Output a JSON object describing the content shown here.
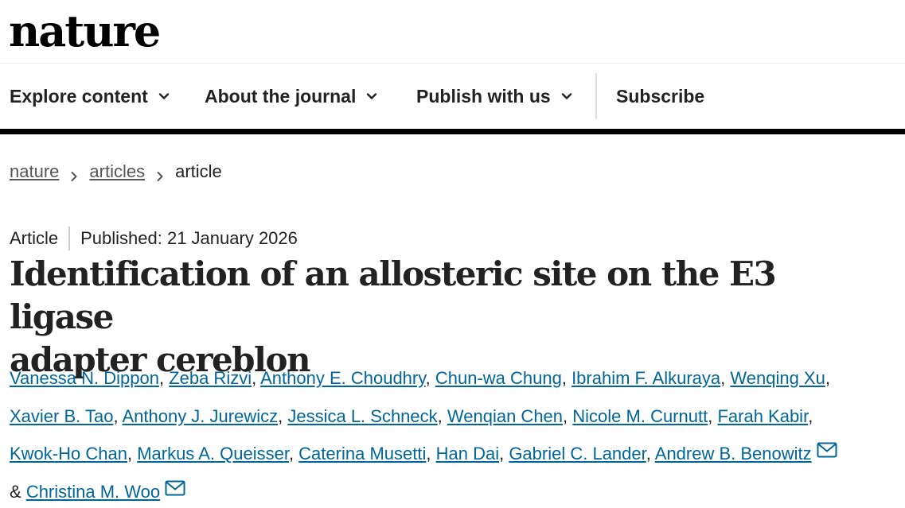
{
  "header": {
    "logo": "nature"
  },
  "nav": {
    "items": [
      {
        "label": "Explore content",
        "has_dropdown": true
      },
      {
        "label": "About the journal",
        "has_dropdown": true
      },
      {
        "label": "Publish with us",
        "has_dropdown": true
      },
      {
        "label": "Subscribe",
        "has_dropdown": false
      }
    ],
    "chevron_icon": "chevron-down-icon"
  },
  "breadcrumb": {
    "items": [
      "nature",
      "articles"
    ],
    "current": "article",
    "separator_icon": "chevron-right-icon"
  },
  "meta": {
    "type": "Article",
    "published": "Published: 21 January 2026"
  },
  "article": {
    "title_line1": "Identification of an allosteric site on the E3 ligase",
    "title_line2": "adapter cereblon"
  },
  "authors": {
    "names": [
      "Vanessa N. Dippon",
      "Zeba Rizvi",
      "Anthony E. Choudhry",
      "Chun-wa Chung",
      "Ibrahim F. Alkuraya",
      "Wenqing Xu",
      "Xavier B. Tao",
      "Anthony J. Jurewicz",
      "Jessica L. Schneck",
      "Wenqian Chen",
      "Nicole M. Curnutt",
      "Farah Kabir",
      "Kwok-Ho Chan",
      "Markus A. Queisser",
      "Caterina Musetti",
      "Han Dai",
      "Gabriel C. Lander",
      "Andrew B. Benowitz",
      "Christina M. Woo"
    ],
    "conjunction": "&",
    "mail_icon": "envelope-icon"
  },
  "colors": {
    "text": "#222222",
    "link": "#006699",
    "breadcrumb_link": "#555555",
    "nav_bar": "#000000"
  }
}
